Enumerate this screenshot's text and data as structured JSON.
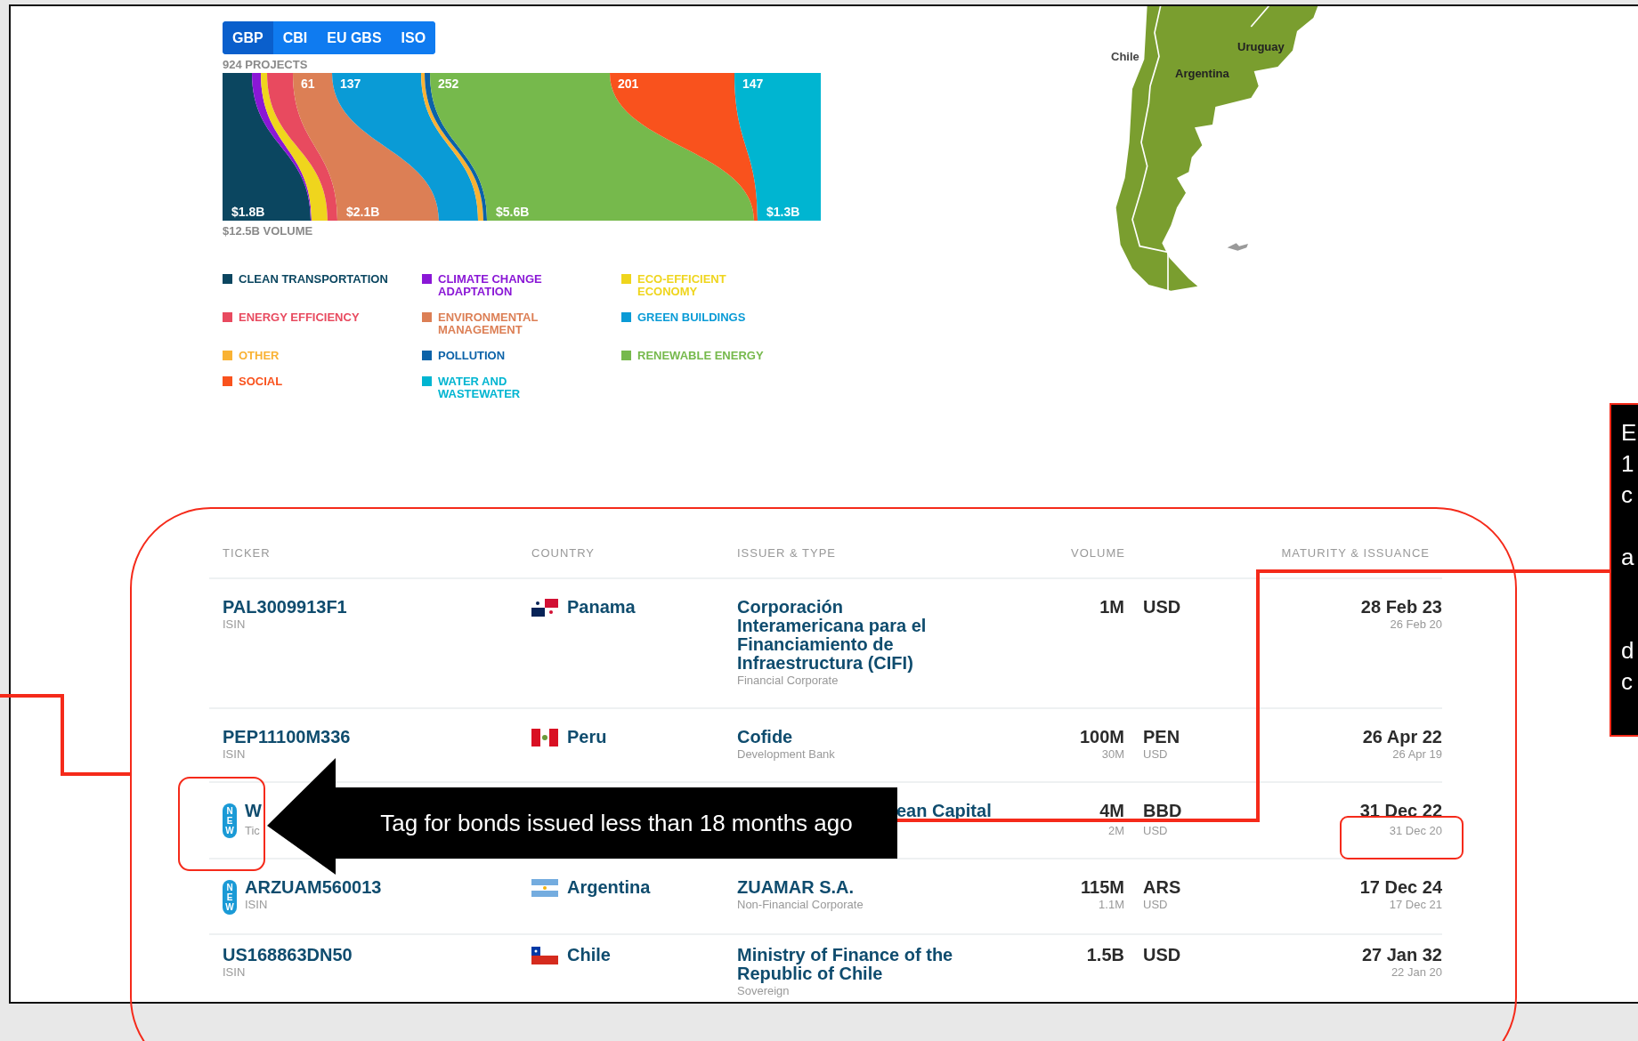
{
  "tabs": [
    {
      "label": "GBP",
      "selected": true
    },
    {
      "label": "CBI",
      "selected": false
    },
    {
      "label": "EU GBS",
      "selected": false
    },
    {
      "label": "ISO",
      "selected": false
    }
  ],
  "chart": {
    "projects": "924 PROJECTS",
    "volume": "$12.5B VOLUME",
    "flows": [
      {
        "color": "#0b4660",
        "volume_label": "$1.8B"
      },
      {
        "color": "#8a17d6"
      },
      {
        "color": "#efd51d"
      },
      {
        "color": "#e84a5f"
      },
      {
        "color": "#dc7f55",
        "count_label": "61",
        "volume_label": "$2.1B"
      },
      {
        "color": "#0a9bd6",
        "count_label": "137"
      },
      {
        "color": "#f9b233"
      },
      {
        "color": "#0b62a8"
      },
      {
        "color": "#76b94c",
        "count_label": "252",
        "volume_label": "$5.6B"
      },
      {
        "color": "#f9521d",
        "count_label": "201"
      },
      {
        "color": "#00b5d1",
        "count_label": "147",
        "volume_label": "$1.3B"
      }
    ]
  },
  "legend": [
    {
      "label": "CLEAN TRANSPORTATION",
      "color": "#0b4660"
    },
    {
      "label": "CLIMATE CHANGE ADAPTATION",
      "color": "#8a17d6"
    },
    {
      "label": "ECO-EFFICIENT ECONOMY",
      "color": "#efd51d"
    },
    {
      "label": "ENERGY EFFICIENCY",
      "color": "#e84a5f"
    },
    {
      "label": "ENVIRONMENTAL MANAGEMENT",
      "color": "#dc7f55"
    },
    {
      "label": "GREEN BUILDINGS",
      "color": "#0a9bd6"
    },
    {
      "label": "OTHER",
      "color": "#f9b233"
    },
    {
      "label": "POLLUTION",
      "color": "#0b62a8"
    },
    {
      "label": "RENEWABLE ENERGY",
      "color": "#76b94c"
    },
    {
      "label": "SOCIAL",
      "color": "#f9521d"
    },
    {
      "label": "WATER AND WASTEWATER",
      "color": "#00b5d1"
    }
  ],
  "map": {
    "labels": [
      {
        "text": "Chile",
        "kind": "chile"
      },
      {
        "text": "Argentina",
        "kind": "argentina"
      },
      {
        "text": "Uruguay",
        "kind": "uruguay"
      }
    ]
  },
  "table": {
    "columns": [
      "TICKER",
      "COUNTRY",
      "ISSUER & TYPE",
      "VOLUME",
      "MATURITY & ISSUANCE"
    ],
    "rows": [
      {
        "ticker": "PAL3009913F1",
        "ticker_type": "ISIN",
        "kind": "panama",
        "country": "Panama",
        "issuer": "Corporación Interamericana para el Financiamiento de Infraestructura (CIFI)",
        "issuer_type": "Financial Corporate",
        "volume": "1M",
        "currency": "USD",
        "maturity": "28 Feb 23",
        "issuance": "26 Feb 20"
      },
      {
        "ticker": "PEP11100M336",
        "ticker_type": "ISIN",
        "kind": "peru",
        "country": "Peru",
        "issuer": "Cofide",
        "issuer_type": "Development Bank",
        "volume": "100M",
        "currency": "PEN",
        "volume_secondary": "30M",
        "currency_secondary": "USD",
        "maturity": "26 Apr 22",
        "issuance": "26 Apr 19"
      },
      {
        "tag": "NEW",
        "ticker": "W",
        "ticker_type": "Tic",
        "partly_hidden": true,
        "issuer": "ean Capital",
        "volume": "4M",
        "currency": "BBD",
        "volume_secondary": "2M",
        "currency_secondary": "USD",
        "maturity": "31 Dec 22",
        "issuance": "31 Dec 20"
      },
      {
        "tag": "NEW",
        "ticker": "ARZUAM560013",
        "ticker_type": "ISIN",
        "kind": "argentina",
        "country": "Argentina",
        "issuer": "ZUAMAR S.A.",
        "issuer_type": "Non-Financial Corporate",
        "volume": "115M",
        "currency": "ARS",
        "volume_secondary": "1.1M",
        "currency_secondary": "USD",
        "maturity": "17 Dec 24",
        "issuance": "17 Dec 21"
      },
      {
        "ticker": "US168863DN50",
        "ticker_type": "ISIN",
        "kind": "chile",
        "country": "Chile",
        "issuer": "Ministry of Finance of the Republic of Chile",
        "issuer_type": "Sovereign",
        "volume": "1.5B",
        "currency": "USD",
        "maturity": "27 Jan 32",
        "issuance": "22 Jan 20"
      }
    ]
  },
  "annotations": [
    {
      "kind": "arrow-callout",
      "text": "Tag for bonds issued less than 18 months ago"
    },
    {
      "kind": "side-note",
      "lines": [
        "E",
        "1",
        "c",
        "a",
        "d",
        "c"
      ]
    }
  ]
}
